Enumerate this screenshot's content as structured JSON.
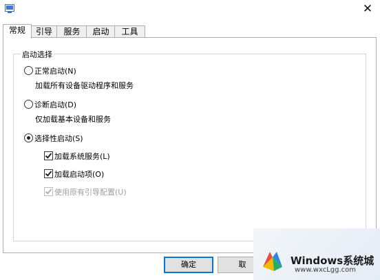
{
  "tabs": [
    "常规",
    "引导",
    "服务",
    "启动",
    "工具"
  ],
  "group": {
    "title": "启动选择",
    "normal_label": "正常启动(N)",
    "normal_desc": "加载所有设备驱动程序和服务",
    "diag_label": "诊断启动(D)",
    "diag_desc": "仅加载基本设备和服务",
    "selective_label": "选择性启动(S)",
    "load_services": "加载系统服务(L)",
    "load_startup": "加载启动项(O)",
    "use_original_boot": "使用原有引导配置(U)"
  },
  "state": {
    "startup_mode": "selective",
    "load_services_checked": true,
    "load_startup_checked": true,
    "use_original_boot_checked": true,
    "use_original_boot_disabled": true
  },
  "buttons": {
    "ok": "确定",
    "cancel_partial": "取"
  },
  "watermark": {
    "brand": "Windows系统城",
    "url": "www.wxcLgg.com"
  },
  "colors": {
    "accent": "#0078d7",
    "tab_bg": "#f0f0f0",
    "border": "#adadad"
  }
}
